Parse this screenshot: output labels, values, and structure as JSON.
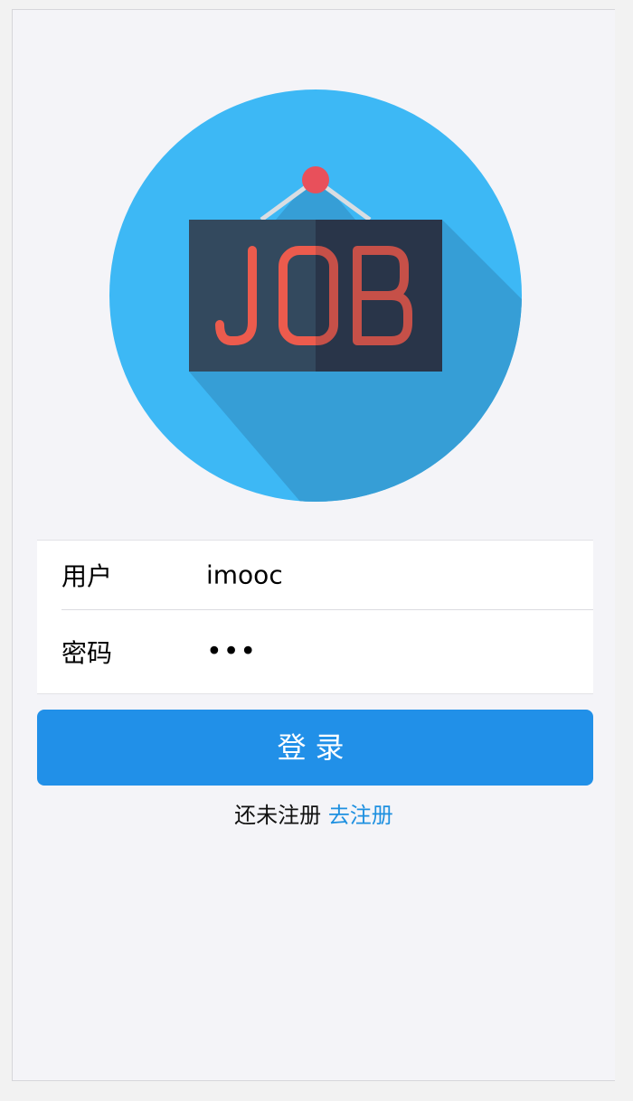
{
  "logo": {
    "text": "JOB",
    "circle_color": "#3db8f5",
    "shadow_color": "#369ed6",
    "board_color": "#33495e",
    "text_color": "#ec5b4d",
    "pin_color": "#e8505b",
    "icon": "job-sign-icon"
  },
  "form": {
    "username_label": "用户",
    "username_value": "imooc",
    "password_label": "密码",
    "password_value": "•••"
  },
  "login_button": {
    "label": "登录",
    "color": "#2190e8"
  },
  "register": {
    "prompt": "还未注册",
    "link": "去注册",
    "link_color": "#1e90e0"
  }
}
